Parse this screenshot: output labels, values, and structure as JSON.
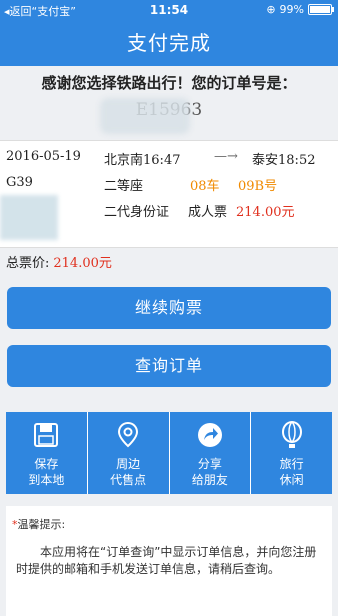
{
  "status_bar": {
    "back_label": "◂返回“支付宝”",
    "time": "11:54",
    "battery": "99%",
    "battery_fraction": 0.99
  },
  "nav": {
    "title": "支付完成"
  },
  "thanks_text": "感谢您选择铁路出行！您的订单号是：",
  "order_number_visible": "E15963",
  "ticket": {
    "date": "2016-05-19",
    "train": "G39",
    "from_station": "北京南",
    "from_time": "16:47",
    "arrow": "—→",
    "to_station": "泰安",
    "to_time": "18:52",
    "seat_class": "二等座",
    "car": "08车",
    "seat": "09B号",
    "id_type": "二代身份证",
    "ticket_type": "成人票",
    "price": "214.00元"
  },
  "total": {
    "label": "总票价:",
    "amount": "214.00元"
  },
  "buttons": {
    "continue": "继续购票",
    "query": "查询订单"
  },
  "actions": [
    {
      "icon": "save-icon",
      "label": "保存\n到本地"
    },
    {
      "icon": "location-pin-icon",
      "label": "周边\n代售点"
    },
    {
      "icon": "share-icon",
      "label": "分享\n给朋友"
    },
    {
      "icon": "hot-air-balloon-icon",
      "label": "旅行\n休闲"
    }
  ],
  "tips": {
    "heading_star": "*",
    "heading": "温馨提示:",
    "body": "本应用将在“订单查询”中显示订单信息，并向您注册时提供的邮箱和手机发送订单信息，请稍后查询。"
  },
  "colors": {
    "primary": "#2f86df",
    "accent_orange": "#f08a00",
    "price_red": "#e0301e"
  }
}
